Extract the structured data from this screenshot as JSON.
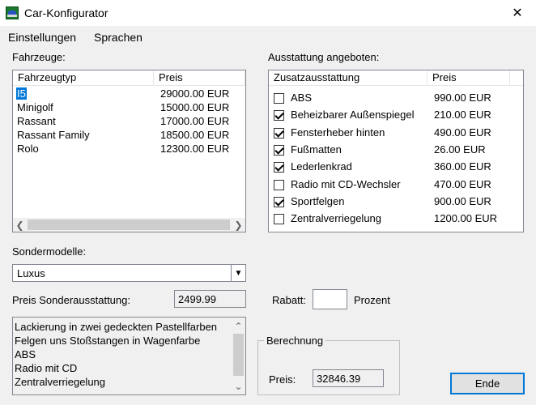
{
  "window": {
    "title": "Car-Konfigurator",
    "close_glyph": "✕",
    "icon": "car-icon"
  },
  "menu": [
    "Einstellungen",
    "Sprachen"
  ],
  "fahrzeuge": {
    "label": "Fahrzeuge:",
    "columns": [
      "Fahrzeugtyp",
      "Preis"
    ],
    "rows": [
      {
        "type": "I5",
        "price": "29000.00 EUR",
        "selected": true
      },
      {
        "type": "Minigolf",
        "price": "15000.00 EUR"
      },
      {
        "type": "Rassant",
        "price": "17000.00 EUR"
      },
      {
        "type": "Rassant Family",
        "price": "18500.00 EUR"
      },
      {
        "type": "Rolo",
        "price": "12300.00 EUR"
      }
    ]
  },
  "ausstattung": {
    "label": "Ausstattung angeboten:",
    "columns": [
      "Zusatzausstattung",
      "Preis"
    ],
    "rows": [
      {
        "name": "ABS",
        "price": "990.00 EUR",
        "checked": false
      },
      {
        "name": "Beheizbarer Außenspiegel",
        "price": "210.00 EUR",
        "checked": true
      },
      {
        "name": "Fensterheber hinten",
        "price": "490.00 EUR",
        "checked": true
      },
      {
        "name": "Fußmatten",
        "price": "26.00 EUR",
        "checked": true
      },
      {
        "name": "Lederlenkrad",
        "price": "360.00 EUR",
        "checked": true
      },
      {
        "name": "Radio mit CD-Wechsler",
        "price": "470.00 EUR",
        "checked": false
      },
      {
        "name": "Sportfelgen",
        "price": "900.00 EUR",
        "checked": true
      },
      {
        "name": "Zentralverriegelung",
        "price": "1200.00 EUR",
        "checked": false
      }
    ]
  },
  "sondermodelle": {
    "label": "Sondermodelle:",
    "selected": "Luxus"
  },
  "preis_sonder": {
    "label": "Preis Sonderausstattung:",
    "value": "2499.99"
  },
  "rabatt": {
    "label": "Rabatt:",
    "value": "",
    "unit": "Prozent"
  },
  "sonder_features": [
    "Lackierung in zwei gedeckten Pastellfarben",
    "Felgen uns Stoßstangen in Wagenfarbe",
    "ABS",
    "Radio mit CD",
    "Zentralverriegelung"
  ],
  "berechnung": {
    "title": "Berechnung",
    "preis_label": "Preis:",
    "preis_value": "32846.39"
  },
  "buttons": {
    "ende": "Ende"
  }
}
